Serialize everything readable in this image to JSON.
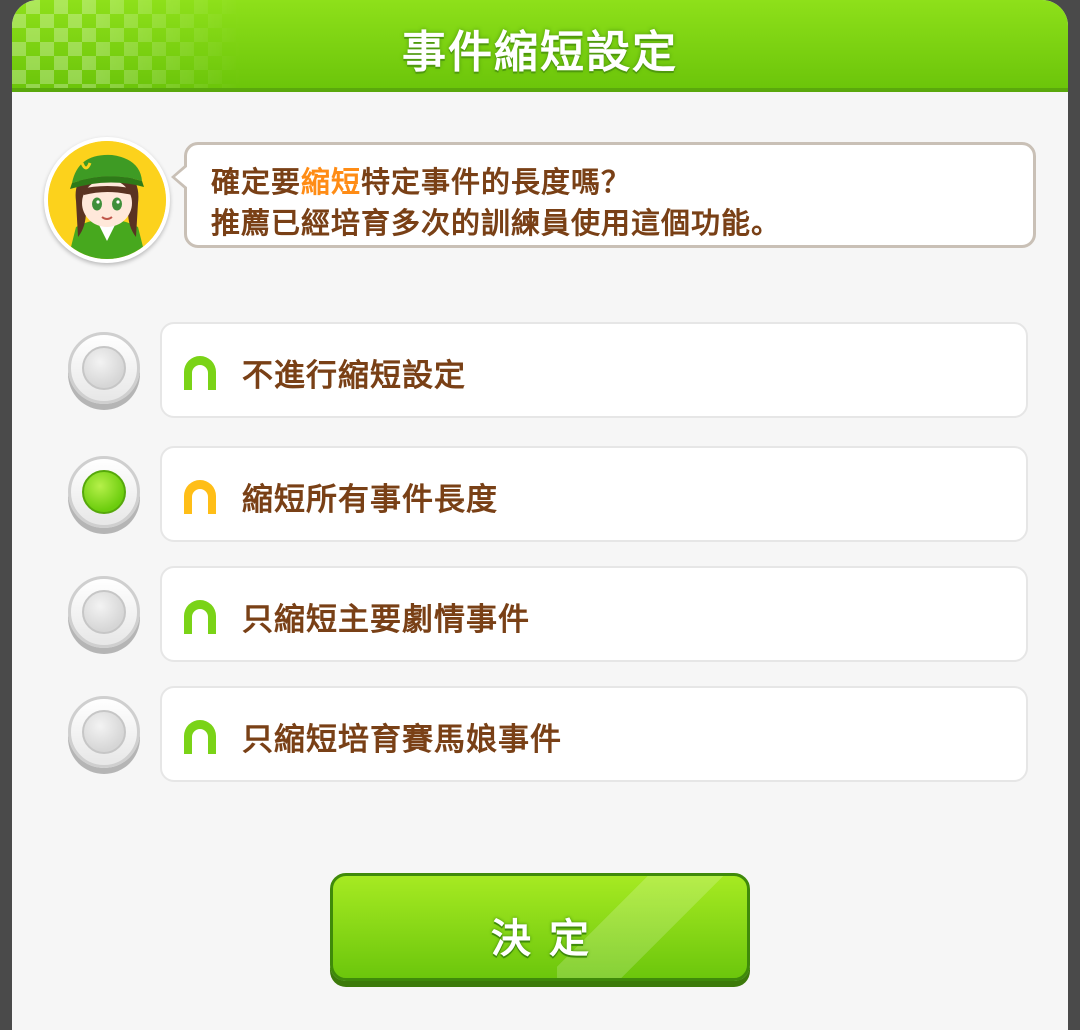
{
  "dialog": {
    "title": "事件縮短設定"
  },
  "speech": {
    "line1_prefix": "確定要",
    "line1_highlight": "縮短",
    "line1_suffix": "特定事件的長度嗎？",
    "line2": "推薦已經培育多次的訓練員使用這個功能。"
  },
  "options": [
    {
      "label": "不進行縮短設定",
      "selected": false,
      "icon": "horseshoe-icon",
      "icon_color": "#7ad317"
    },
    {
      "label": "縮短所有事件長度",
      "selected": true,
      "icon": "horseshoe-icon",
      "icon_color": "#ffbe17"
    },
    {
      "label": "只縮短主要劇情事件",
      "selected": false,
      "icon": "horseshoe-icon",
      "icon_color": "#7ad317"
    },
    {
      "label": "只縮短培育賽馬娘事件",
      "selected": false,
      "icon": "horseshoe-icon",
      "icon_color": "#7ad317"
    }
  ],
  "confirm_button": {
    "label": "決定"
  },
  "colors": {
    "accent_green": "#7ad317",
    "highlight_orange": "#ff8c15",
    "text_brown": "#794016"
  }
}
